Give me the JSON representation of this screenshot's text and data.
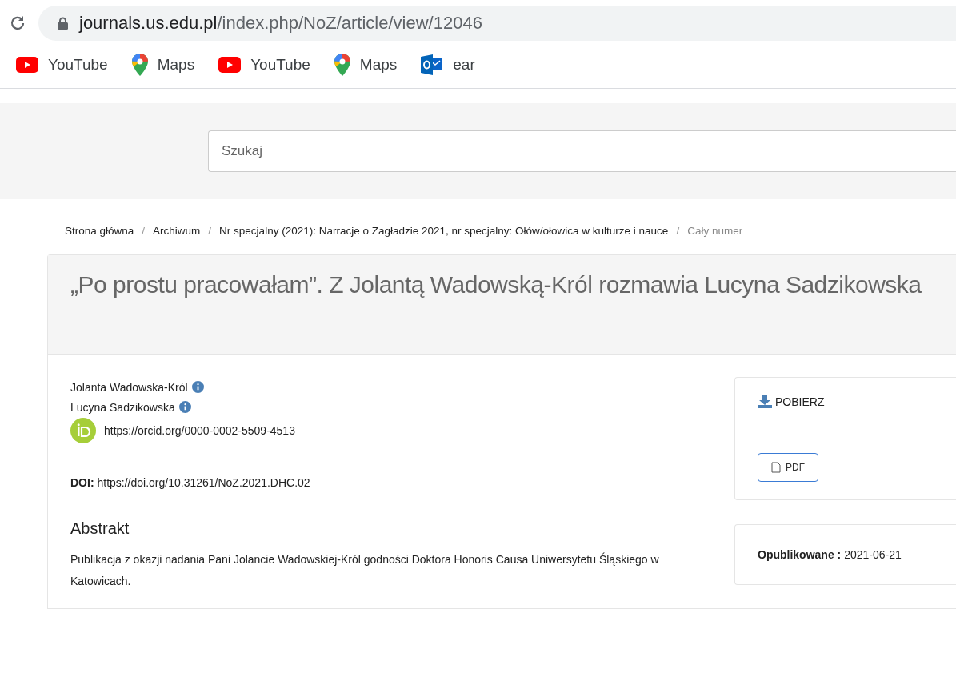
{
  "browser": {
    "url_host": "journals.us.edu.pl",
    "url_path": "/index.php/NoZ/article/view/12046",
    "bookmarks": [
      {
        "kind": "youtube",
        "label": "YouTube"
      },
      {
        "kind": "maps",
        "label": "Maps"
      },
      {
        "kind": "youtube",
        "label": "YouTube"
      },
      {
        "kind": "maps",
        "label": "Maps"
      },
      {
        "kind": "outlook",
        "label": "ear"
      }
    ]
  },
  "search": {
    "placeholder": "Szukaj"
  },
  "breadcrumb_separator": "/",
  "breadcrumbs": [
    {
      "label": "Strona główna",
      "current": false
    },
    {
      "label": "Archiwum",
      "current": false
    },
    {
      "label": "Nr specjalny (2021): Narracje o Zagładzie 2021, nr specjalny: Ołów/ołowica w kulturze i nauce",
      "current": false
    },
    {
      "label": "Cały numer",
      "current": true
    }
  ],
  "article": {
    "title": "„Po prostu pracowałam”. Z Jolantą Wadowską-Król rozmawia Lucyna Sadzikowska",
    "authors": [
      {
        "name": "Jolanta Wadowska-Król"
      },
      {
        "name": "Lucyna Sadzikowska",
        "orcid": "https://orcid.org/0000-0002-5509-4513"
      }
    ],
    "doi_label": "DOI:",
    "doi": "https://doi.org/10.31261/NoZ.2021.DHC.02",
    "abstract_heading": "Abstrakt",
    "abstract": "Publikacja z okazji nadania Pani Jolancie Wadowskiej-Król godności Doktora Honoris Causa Uniwersytetu Śląskiego w Katowicach."
  },
  "sidebar": {
    "download_label": "POBIERZ",
    "galleys": [
      "PDF"
    ],
    "published_label": "Opublikowane :",
    "published_date": "2021-06-21"
  }
}
